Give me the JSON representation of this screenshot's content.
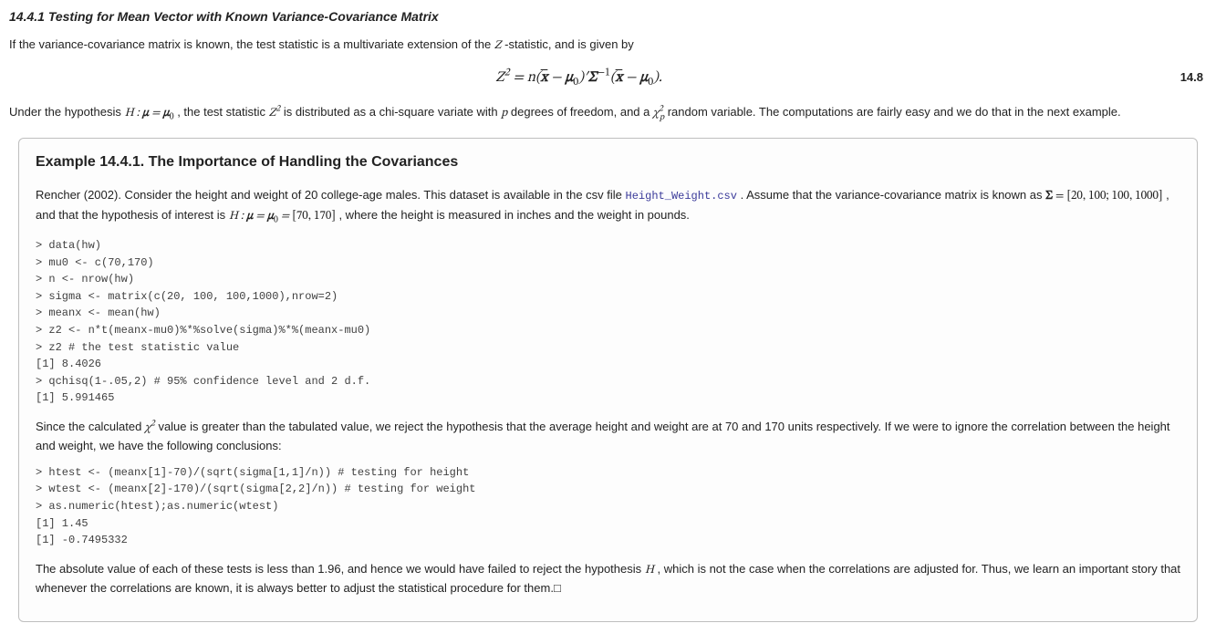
{
  "section": {
    "number": "14.4.1",
    "title": "Testing for Mean Vector with Known Variance-Covariance Matrix"
  },
  "intro": {
    "pre": "If the variance-covariance matrix is known, the test statistic is a multivariate extension of the ",
    "Z": "Z",
    "post": " -statistic, and is given by"
  },
  "equation": {
    "lhs": "Z",
    "sq": "2",
    "rhs_text": " = n(x̄ − μ₀)′Σ⁻¹(x̄ − μ₀).",
    "num": "14.8"
  },
  "under": {
    "t1": "Under the hypothesis ",
    "H": "H : μ = μ₀",
    "t2": ", the test statistic ",
    "Z2": "Z",
    "sq": "2",
    "t3": " is distributed as a chi-square variate with ",
    "p": "p",
    "t4": " degrees of freedom, and a ",
    "chi": "χ",
    "chisub": "p",
    "chisup": "2",
    "t5": " random variable. The computations are fairly easy and we do that in the next example."
  },
  "example": {
    "title": "Example 14.4.1. The Importance of Handling the Covariances",
    "p1a": "Rencher (2002). Consider the height and weight of 20 college-age males. This dataset is available in the csv file ",
    "file": "Height_Weight.csv",
    "p1b": ". Assume that the variance-covariance matrix is known as ",
    "sigma": "Σ = [20, 100; 100, 1000]",
    "p1c": ", and that the hypothesis of interest is ",
    "hyp": "H : μ = μ₀ = [70, 170]",
    "p1d": ", where the height is measured in inches and the weight in pounds.",
    "code1": "> data(hw)\n> mu0 <- c(70,170)\n> n <- nrow(hw)\n> sigma <- matrix(c(20, 100, 100,1000),nrow=2)\n> meanx <- mean(hw)\n> z2 <- n*t(meanx-mu0)%*%solve(sigma)%*%(meanx-mu0)\n> z2 # the test statistic value\n[1] 8.4026\n> qchisq(1-.05,2) # 95% confidence level and 2 d.f.\n[1] 5.991465",
    "p2a": "Since the calculated ",
    "chi2": "χ",
    "chi2sup": "2",
    "p2b": " value is greater than the tabulated value, we reject the hypothesis that the average height and weight are at 70 and 170 units respectively. If we were to ignore the correlation between the height and weight, we have the following conclusions:",
    "code2": "> htest <- (meanx[1]-70)/(sqrt(sigma[1,1]/n)) # testing for height\n> wtest <- (meanx[2]-170)/(sqrt(sigma[2,2]/n)) # testing for weight\n> as.numeric(htest);as.numeric(wtest)\n[1] 1.45\n[1] -0.7495332",
    "p3a": "The absolute value of each of these tests is less than 1.96, and hence we would have failed to reject the hypothesis ",
    "H2": "H",
    "p3b": " , which is not the case when the correlations are adjusted for. Thus, we learn an important story that whenever the correlations are known, it is always better to adjust the statistical procedure for them.□"
  }
}
